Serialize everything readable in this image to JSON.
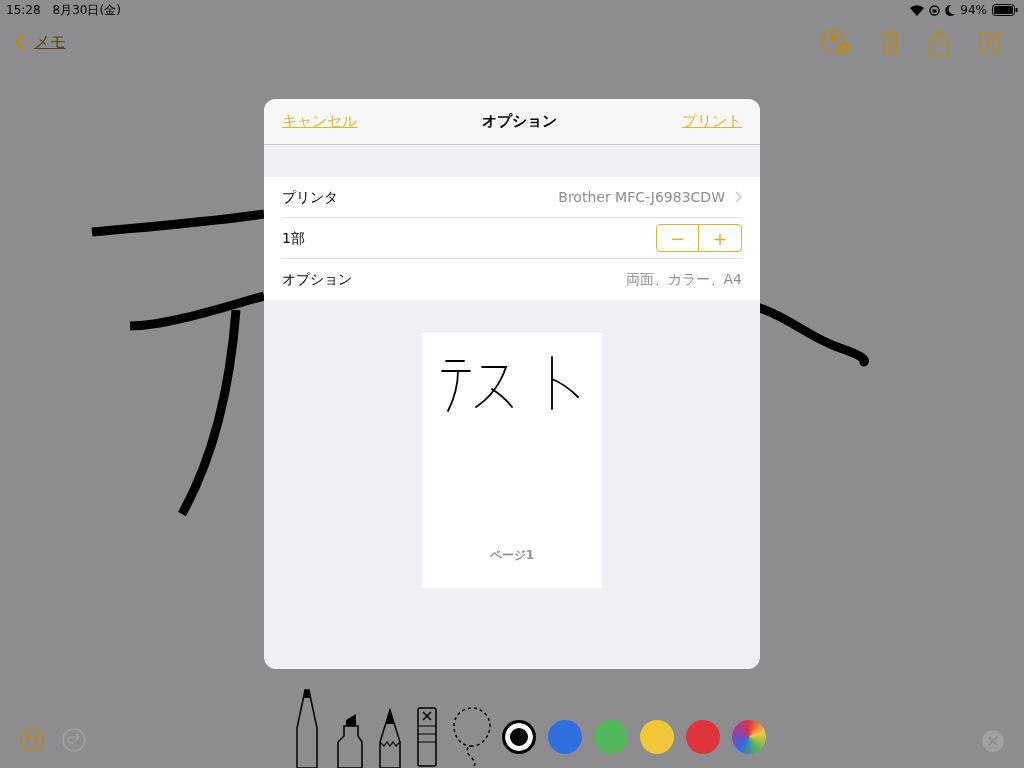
{
  "status_bar": {
    "time": "15:28",
    "date": "8月30日(金)",
    "battery": "94%"
  },
  "nav": {
    "back": "メモ"
  },
  "sheet": {
    "cancel": "キャンセル",
    "title": "オプション",
    "print": "プリント",
    "rows": [
      {
        "kind": "link",
        "label": "プリンタ",
        "value": "Brother MFC-J6983CDW"
      },
      {
        "kind": "stepper",
        "label": "1部",
        "minus": "−",
        "plus": "+"
      },
      {
        "kind": "detail",
        "label": "オプション",
        "value": "両面、カラー、A4"
      }
    ],
    "preview": {
      "page_label": "ページ1"
    }
  },
  "colors": [
    {
      "color": "#000000",
      "selected": true
    },
    {
      "color": "#2f6fe0",
      "selected": false
    },
    {
      "color": "#53b65a",
      "selected": false
    },
    {
      "color": "#f3c73a",
      "selected": false
    },
    {
      "color": "#e0343c",
      "selected": false
    }
  ]
}
